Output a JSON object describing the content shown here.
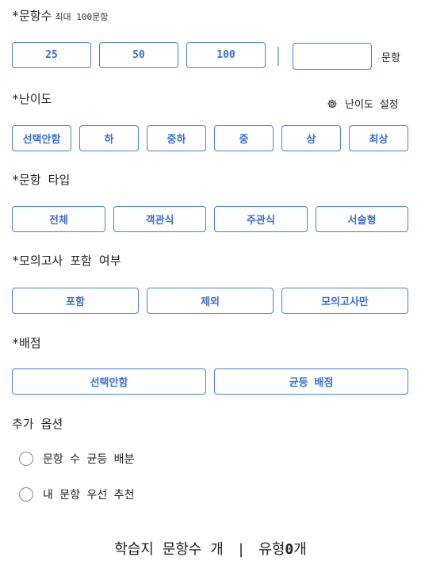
{
  "count": {
    "title": "*문항수",
    "note": "최대 100문항",
    "options": [
      "25",
      "50",
      "100"
    ],
    "input_value": "",
    "input_placeholder": "",
    "unit": "문항"
  },
  "difficulty": {
    "title": "*난이도",
    "settings_label": "난이도 설정",
    "options": [
      "선택안함",
      "하",
      "중하",
      "중",
      "상",
      "최상"
    ]
  },
  "type": {
    "title": "*문항 타입",
    "options": [
      "전체",
      "객관식",
      "주관식",
      "서술형"
    ]
  },
  "mock": {
    "title": "*모의고사 포함 여부",
    "options": [
      "포함",
      "제외",
      "모의고사만"
    ]
  },
  "score": {
    "title": "*배점",
    "options": [
      "선택안함",
      "균등 배점"
    ]
  },
  "extra": {
    "title": "추가 옵션",
    "options": [
      "문항 수 균등 배분",
      "내 문항 우선 추천"
    ]
  },
  "footer": {
    "text_a": "학습지 문항수 개",
    "divider": "|",
    "text_b": "유형",
    "type_count": "0",
    "text_c": "개"
  },
  "colors": {
    "accent": "#3a6fcf",
    "border": "#4a7fd4"
  }
}
